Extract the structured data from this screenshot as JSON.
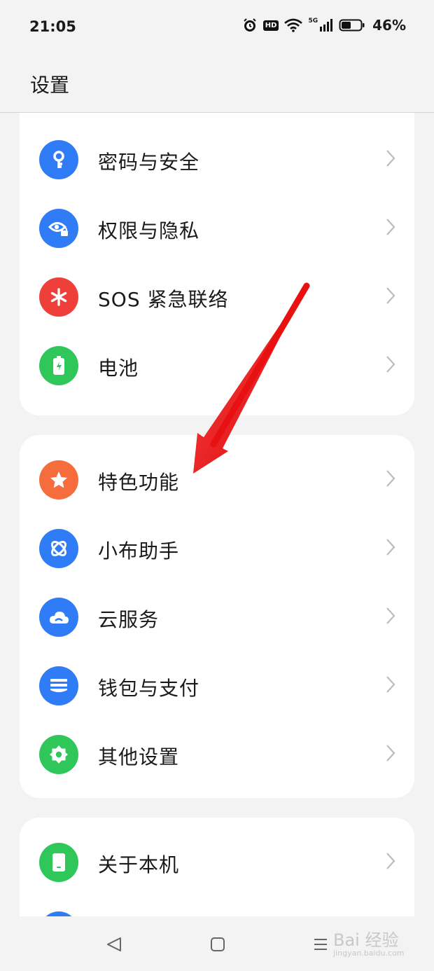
{
  "status_bar": {
    "time": "21:05",
    "hd": "HD",
    "network": "5G",
    "battery": "46%"
  },
  "header": {
    "title": "设置"
  },
  "card1": {
    "items": [
      {
        "label": "密码与安全",
        "icon": "key-icon",
        "color": "#2f7cf6"
      },
      {
        "label": "权限与隐私",
        "icon": "privacy-eye-lock-icon",
        "color": "#2f7cf6"
      },
      {
        "label": "SOS 紧急联络",
        "icon": "asterisk-icon",
        "color": "#ef3f3b"
      },
      {
        "label": "电池",
        "icon": "battery-icon",
        "color": "#2fc75a"
      }
    ]
  },
  "card2": {
    "items": [
      {
        "label": "特色功能",
        "icon": "star-icon",
        "color": "#f56c3d"
      },
      {
        "label": "小布助手",
        "icon": "assistant-orbit-icon",
        "color": "#2f7cf6"
      },
      {
        "label": "云服务",
        "icon": "cloud-icon",
        "color": "#2f7cf6"
      },
      {
        "label": "钱包与支付",
        "icon": "wallet-icon",
        "color": "#2f7cf6"
      },
      {
        "label": "其他设置",
        "icon": "gear-icon",
        "color": "#2fc75a"
      }
    ]
  },
  "card3": {
    "items": [
      {
        "label": "关于本机",
        "icon": "phone-icon",
        "color": "#2fc75a"
      }
    ]
  },
  "watermark": {
    "brand": "Bai 经验",
    "url": "jingyan.baidu.com"
  }
}
